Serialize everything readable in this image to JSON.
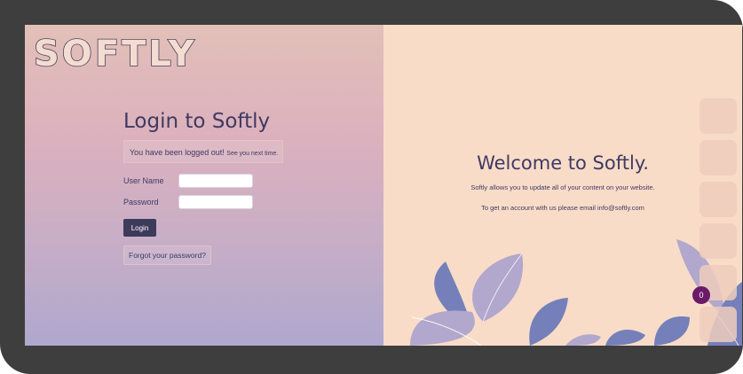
{
  "brand": {
    "logo_text": "SOFTLY"
  },
  "login": {
    "title": "Login to Softly",
    "notice_main": "You have been logged out!",
    "notice_small": "See you next time.",
    "username_label": "User Name",
    "username_value": "",
    "password_label": "Password",
    "password_value": "",
    "login_button": "Login",
    "forgot_button": "Forgot your password?"
  },
  "welcome": {
    "title": "Welcome to Softly.",
    "description": "Softly allows you to update all of your content on your website.",
    "contact": "To get an account with us please email info@softly.com"
  },
  "badge": {
    "count": "0"
  },
  "colors": {
    "frame": "#3e3e3e",
    "accent": "#3f3a63",
    "button": "#3d3a5c",
    "right_bg": "#f8dcc8",
    "leaf_blue": "#7580ba",
    "leaf_lilac": "#b2a7cc",
    "badge": "#6a1a69"
  }
}
